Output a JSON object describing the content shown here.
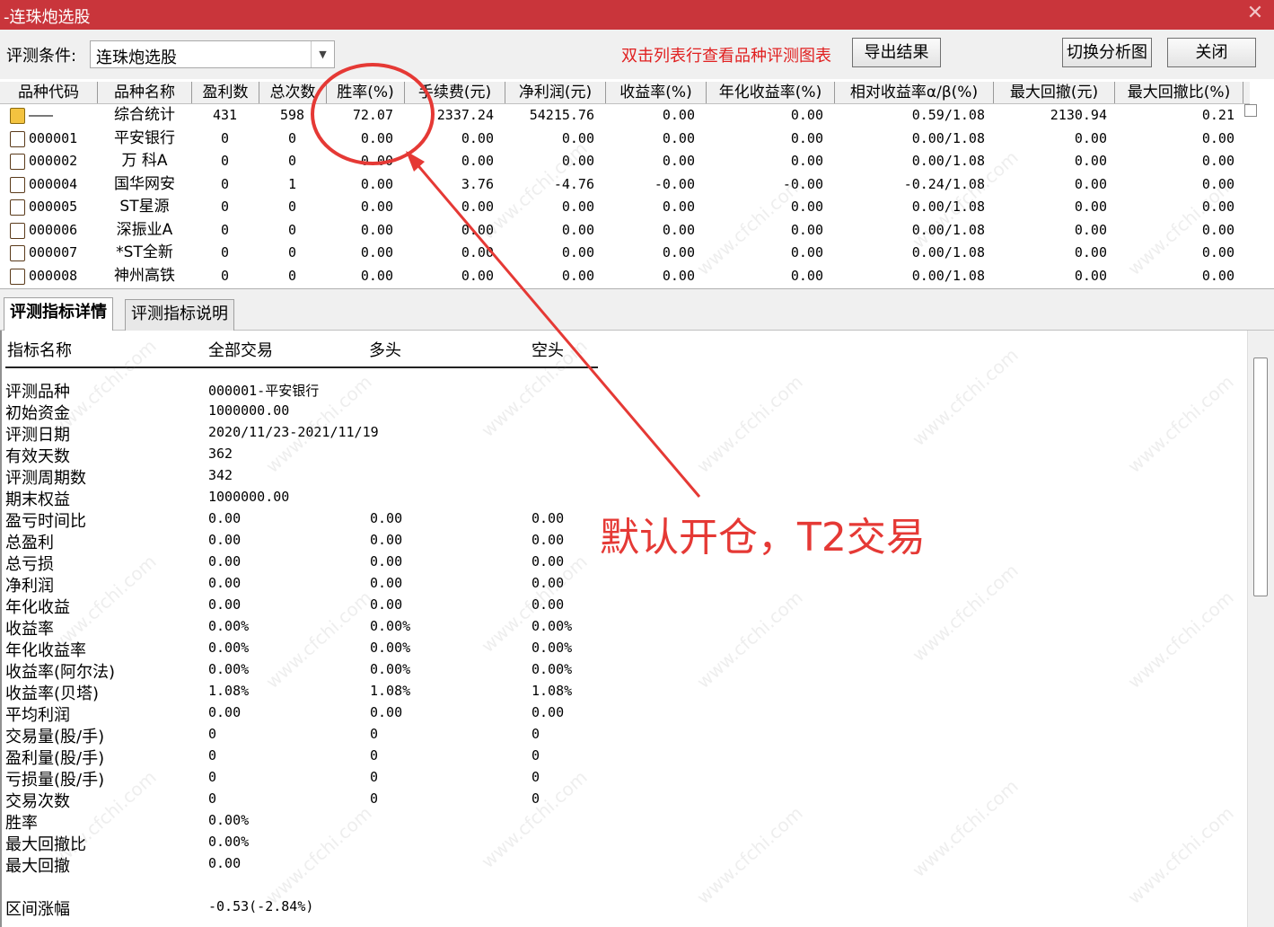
{
  "window": {
    "title": "-连珠炮选股",
    "close_glyph": "✕"
  },
  "toolbar": {
    "condition_label": "评测条件:",
    "condition_value": "连珠炮选股",
    "hint": "双击列表行查看品种评测图表",
    "export_label": "导出结果",
    "switch_chart_label": "切换分析图",
    "close_label": "关闭"
  },
  "grid": {
    "columns": [
      "品种代码",
      "品种名称",
      "盈利数",
      "总次数",
      "胜率(%)",
      "手续费(元)",
      "净利润(元)",
      "收益率(%)",
      "年化收益率(%)",
      "相对收益率α/β(%)",
      "最大回撤(元)",
      "最大回撤比(%)"
    ],
    "rows": [
      {
        "code": "———",
        "name": "综合统计",
        "wins": "431",
        "total": "598",
        "win_rate": "72.07",
        "fee": "2337.24",
        "net_profit": "54215.76",
        "return": "0.00",
        "annual_return": "0.00",
        "rel_return": "0.59/1.08",
        "max_dd": "2130.94",
        "max_dd_ratio": "0.21",
        "icon": "summary-icon"
      },
      {
        "code": "000001",
        "name": "平安银行",
        "wins": "0",
        "total": "0",
        "win_rate": "0.00",
        "fee": "0.00",
        "net_profit": "0.00",
        "return": "0.00",
        "annual_return": "0.00",
        "rel_return": "0.00/1.08",
        "max_dd": "0.00",
        "max_dd_ratio": "0.00",
        "icon": "stock-icon"
      },
      {
        "code": "000002",
        "name": "万 科A",
        "wins": "0",
        "total": "0",
        "win_rate": "0.00",
        "fee": "0.00",
        "net_profit": "0.00",
        "return": "0.00",
        "annual_return": "0.00",
        "rel_return": "0.00/1.08",
        "max_dd": "0.00",
        "max_dd_ratio": "0.00",
        "icon": "stock-icon"
      },
      {
        "code": "000004",
        "name": "国华网安",
        "wins": "0",
        "total": "1",
        "win_rate": "0.00",
        "fee": "3.76",
        "net_profit": "-4.76",
        "return": "-0.00",
        "annual_return": "-0.00",
        "rel_return": "-0.24/1.08",
        "max_dd": "0.00",
        "max_dd_ratio": "0.00",
        "icon": "stock-icon"
      },
      {
        "code": "000005",
        "name": "ST星源",
        "wins": "0",
        "total": "0",
        "win_rate": "0.00",
        "fee": "0.00",
        "net_profit": "0.00",
        "return": "0.00",
        "annual_return": "0.00",
        "rel_return": "0.00/1.08",
        "max_dd": "0.00",
        "max_dd_ratio": "0.00",
        "icon": "stock-icon"
      },
      {
        "code": "000006",
        "name": "深振业A",
        "wins": "0",
        "total": "0",
        "win_rate": "0.00",
        "fee": "0.00",
        "net_profit": "0.00",
        "return": "0.00",
        "annual_return": "0.00",
        "rel_return": "0.00/1.08",
        "max_dd": "0.00",
        "max_dd_ratio": "0.00",
        "icon": "stock-icon"
      },
      {
        "code": "000007",
        "name": "*ST全新",
        "wins": "0",
        "total": "0",
        "win_rate": "0.00",
        "fee": "0.00",
        "net_profit": "0.00",
        "return": "0.00",
        "annual_return": "0.00",
        "rel_return": "0.00/1.08",
        "max_dd": "0.00",
        "max_dd_ratio": "0.00",
        "icon": "stock-icon"
      },
      {
        "code": "000008",
        "name": "神州高铁",
        "wins": "0",
        "total": "0",
        "win_rate": "0.00",
        "fee": "0.00",
        "net_profit": "0.00",
        "return": "0.00",
        "annual_return": "0.00",
        "rel_return": "0.00/1.08",
        "max_dd": "0.00",
        "max_dd_ratio": "0.00",
        "icon": "stock-icon"
      }
    ]
  },
  "tabs": [
    {
      "label": "评测指标详情",
      "active": true
    },
    {
      "label": "评测指标说明",
      "active": false
    }
  ],
  "detail": {
    "headers": [
      "指标名称",
      "全部交易",
      "多头",
      "空头"
    ],
    "rows": [
      {
        "label": "评测品种",
        "all": "000001-平安银行",
        "long": "",
        "short": ""
      },
      {
        "label": "初始资金",
        "all": "1000000.00",
        "long": "",
        "short": ""
      },
      {
        "label": "评测日期",
        "all": "2020/11/23-2021/11/19",
        "long": "",
        "short": ""
      },
      {
        "label": "有效天数",
        "all": "362",
        "long": "",
        "short": ""
      },
      {
        "label": "评测周期数",
        "all": "342",
        "long": "",
        "short": ""
      },
      {
        "label": "期末权益",
        "all": "1000000.00",
        "long": "",
        "short": ""
      },
      {
        "label": "盈亏时间比",
        "all": "0.00",
        "long": "0.00",
        "short": "0.00"
      },
      {
        "label": "总盈利",
        "all": "0.00",
        "long": "0.00",
        "short": "0.00"
      },
      {
        "label": "总亏损",
        "all": "0.00",
        "long": "0.00",
        "short": "0.00"
      },
      {
        "label": "净利润",
        "all": "0.00",
        "long": "0.00",
        "short": "0.00"
      },
      {
        "label": "年化收益",
        "all": "0.00",
        "long": "0.00",
        "short": "0.00"
      },
      {
        "label": "收益率",
        "all": "0.00%",
        "long": "0.00%",
        "short": "0.00%"
      },
      {
        "label": "年化收益率",
        "all": "0.00%",
        "long": "0.00%",
        "short": "0.00%"
      },
      {
        "label": "收益率(阿尔法)",
        "all": "0.00%",
        "long": "0.00%",
        "short": "0.00%"
      },
      {
        "label": "收益率(贝塔)",
        "all": "1.08%",
        "long": "1.08%",
        "short": "1.08%"
      },
      {
        "label": "平均利润",
        "all": "0.00",
        "long": "0.00",
        "short": "0.00"
      },
      {
        "label": "交易量(股/手)",
        "all": "0",
        "long": "0",
        "short": "0"
      },
      {
        "label": "盈利量(股/手)",
        "all": "0",
        "long": "0",
        "short": "0"
      },
      {
        "label": "亏损量(股/手)",
        "all": "0",
        "long": "0",
        "short": "0"
      },
      {
        "label": "交易次数",
        "all": "0",
        "long": "0",
        "short": "0"
      },
      {
        "label": "胜率",
        "all": "0.00%",
        "long": "",
        "short": ""
      },
      {
        "label": "最大回撤比",
        "all": "0.00%",
        "long": "",
        "short": ""
      },
      {
        "label": "最大回撤",
        "all": "0.00",
        "long": "",
        "short": ""
      },
      {
        "label": "",
        "all": "",
        "long": "",
        "short": ""
      },
      {
        "label": "区间涨幅",
        "all": "-0.53(-2.84%)",
        "long": "",
        "short": ""
      }
    ]
  },
  "annotation": {
    "text": "默认开仓，T2交易",
    "color": "#e53935"
  },
  "watermark": "www.cfchi.com",
  "colors": {
    "titlebar": "#c9353b",
    "hint": "#e02020"
  }
}
